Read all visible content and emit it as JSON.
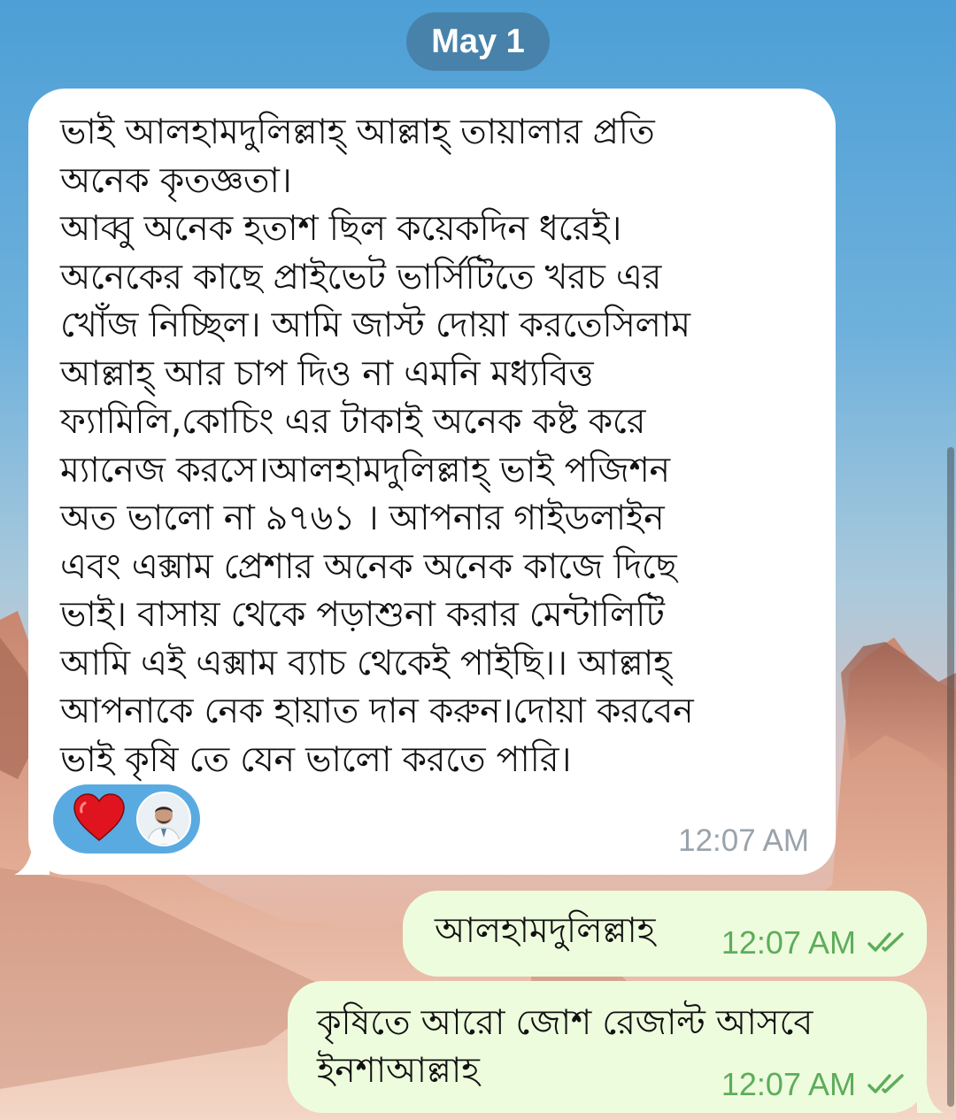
{
  "date_separator": "May 1",
  "incoming_message": {
    "text": "ভাই আলহামদুলিল্লাহ্ আল্লাহ্ তায়ালার প্রতি\nঅনেক কৃতজ্ঞতা।\nআব্বু অনেক হতাশ ছিল কয়েকদিন ধরেই।\nঅনেকের কাছে প্রাইভেট ভার্সিটিতে খরচ এর\nখোঁজ নিচ্ছিল। আমি জাস্ট দোয়া করতেসিলাম\nআল্লাহ্ আর চাপ দিও না এমনি মধ্যবিত্ত\nফ্যামিলি,কোচিং এর টাকাই অনেক কষ্ট করে\nম্যানেজ করসে।আলহামদুলিল্লাহ্ ভাই পজিশন\nঅত ভালো না ৯৭৬১ । আপনার গাইডলাইন\nএবং এক্সাম প্রেশার অনেক অনেক কাজে দিছে\nভাই। বাসায় থেকে পড়াশুনা করার মেন্টালিটি\nআমি এই এক্সাম ব্যাচ থেকেই পাইছি।। আল্লাহ্\nআপনাকে নেক হায়াত দান করুন।দোয়া করবেন\nভাই কৃষি তে যেন ভালো করতে পারি।",
    "time": "12:07 AM",
    "reaction": {
      "emoji": "heart-icon",
      "color": "#e0141e"
    }
  },
  "outgoing_messages": [
    {
      "text": "আলহামদুলিল্লাহ",
      "time": "12:07 AM",
      "status": "double-check-icon"
    },
    {
      "text": "কৃষিতে আরো জোশ রেজাল্ট আসবে\nইনশাআল্লাহ",
      "time": "12:07 AM",
      "status": "double-check-icon"
    }
  ],
  "colors": {
    "incoming_bubble": "#ffffff",
    "outgoing_bubble": "#eefcde",
    "outgoing_time": "#5dad5a",
    "incoming_time": "#9aa3ab",
    "reaction_pill": "#5aaae2",
    "date_pill": "#447698"
  }
}
